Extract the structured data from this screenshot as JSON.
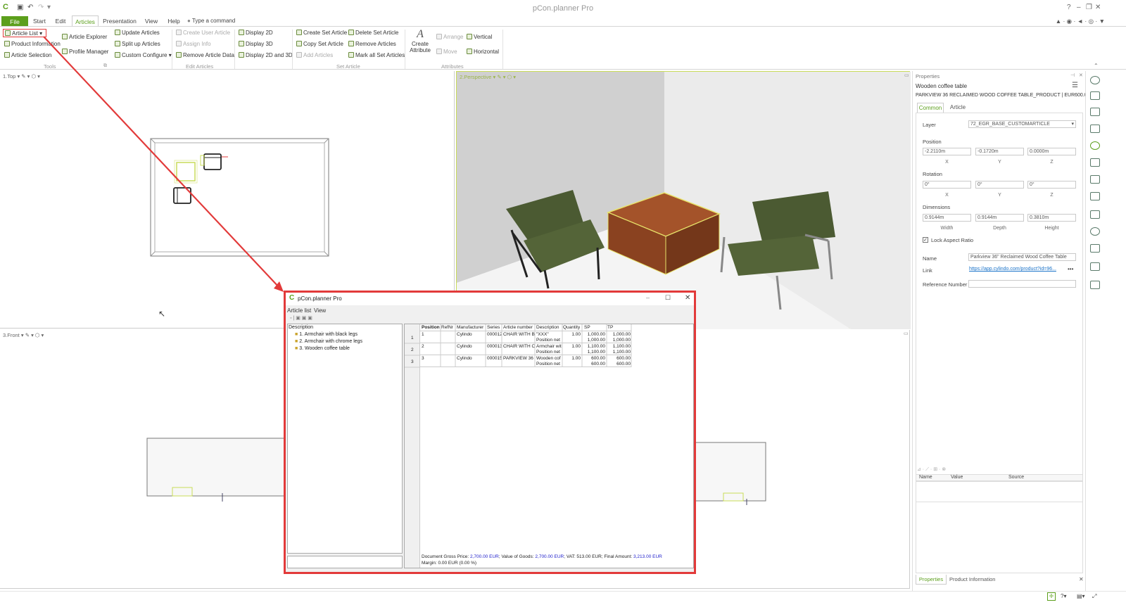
{
  "app": {
    "title": "pCon.planner Pro"
  },
  "menu": {
    "tabs": [
      "File",
      "Start",
      "Edit",
      "Articles",
      "Presentation",
      "View",
      "Help"
    ],
    "command_label": "Type a command"
  },
  "ribbon": {
    "tools": {
      "article_list": "Article List",
      "product_information": "Product Information",
      "article_selection": "Article Selection",
      "article_explorer": "Article Explorer",
      "profile_manager": "Profile Manager",
      "group": "Tools"
    },
    "articles": {
      "update": "Update Articles",
      "split": "Split up Articles",
      "custom": "Custom Configure"
    },
    "edit": {
      "create_user": "Create User Article",
      "assign_info": "Assign Info",
      "remove_data": "Remove Article Data",
      "group": "Edit Articles"
    },
    "display": {
      "d2": "Display 2D",
      "d3": "Display 3D",
      "d23": "Display 2D and 3D"
    },
    "set": {
      "create": "Create Set Article",
      "copy": "Copy Set Article",
      "add": "Add Articles",
      "delete": "Delete Set Article",
      "remove": "Remove Articles",
      "mark": "Mark all Set Articles",
      "group": "Set Article"
    },
    "attributes": {
      "create_line1": "Create",
      "create_line2": "Attribute",
      "arrange": "Arrange",
      "move": "Move",
      "vertical": "Vertical",
      "horizontal": "Horizontal",
      "group": "Attributes"
    }
  },
  "viewports": {
    "top": "1.Top",
    "perspective": "2.Perspective",
    "front": "3.Front"
  },
  "properties": {
    "header": "Properties",
    "object_name": "Wooden coffee table",
    "object_desc": "PARKVIEW 36 RECLAIMED WOOD COFFEE TABLE_PRODUCT | EUR600.00",
    "tabs": [
      "Common",
      "Article"
    ],
    "layer_label": "Layer",
    "layer_value": "72_EGR_BASE_CUSTOMARTICLE",
    "position_label": "Position",
    "position": [
      "-2.2110m",
      "-0.1720m",
      "0.0000m"
    ],
    "rotation_label": "Rotation",
    "rotation": [
      "0°",
      "0°",
      "0°"
    ],
    "axes": [
      "X",
      "Y",
      "Z"
    ],
    "dimensions_label": "Dimensions",
    "dimensions": [
      "0.9144m",
      "0.9144m",
      "0.3810m"
    ],
    "dim_labels": [
      "Width",
      "Depth",
      "Height"
    ],
    "lock_label": "Lock Aspect Ratio",
    "name_label": "Name",
    "name_value": "Parkview 36\" Reclaimed Wood Coffee Table",
    "link_label": "Link",
    "link_value": "https://app.cylindo.com/product?id=96...",
    "refnum_label": "Reference Number",
    "table_cols": [
      "Name",
      "Value",
      "Source"
    ],
    "bottom_tabs": [
      "Properties",
      "Product Information"
    ]
  },
  "dialog": {
    "title": "pCon.planner Pro",
    "menu": [
      "Article list",
      "View"
    ],
    "tree_header": "Description",
    "tree_items": [
      "1. Armchair with black legs",
      "2. Armchair with chrome legs",
      "3. Wooden coffee table"
    ],
    "columns": [
      "Position",
      "RefNr",
      "Manufacturer",
      "Series",
      "Article number",
      "Description",
      "Quantity",
      "SP",
      "TP"
    ],
    "rows": [
      {
        "rownum": "1",
        "pos": "1",
        "mfr": "Cylindo",
        "series": "000012",
        "art": "CHAIR WITH B",
        "desc": "\"XXX\"",
        "desc2": "Position net",
        "qty": "1.00",
        "sp": "1,000.00",
        "sp2": "1,000.00",
        "tp": "1,000.00",
        "tp2": "1,000.00"
      },
      {
        "rownum": "2",
        "pos": "2",
        "mfr": "Cylindo",
        "series": "000013",
        "art": "CHAIR WITH C",
        "desc": "Armchair wit",
        "desc2": "Position net",
        "qty": "1.00",
        "sp": "1,100.00",
        "sp2": "1,100.00",
        "tp": "1,100.00",
        "tp2": "1,100.00"
      },
      {
        "rownum": "3",
        "pos": "3",
        "mfr": "Cylindo",
        "series": "000015",
        "art": "PARKVIEW 36",
        "desc": "Wooden cof",
        "desc2": "Position net",
        "qty": "1.00",
        "sp": "600.00",
        "sp2": "600.00",
        "tp": "600.00",
        "tp2": "600.00"
      }
    ],
    "footer1_a": "Document Gross Price:",
    "footer1_b": "2,700.00 EUR",
    "footer1_c": "; Value of Goods:",
    "footer1_d": "2,700.00 EUR",
    "footer1_e": "; VAT: 513.00 EUR; Final Amount:",
    "footer1_f": "3,213.00 EUR",
    "footer2": "Margin: 0.00 EUR (0.00 %)"
  },
  "colors": {
    "accent": "#5c9f1c",
    "highlight": "#e23a3a",
    "link": "#1a73c9",
    "price_blue": "#2222cc"
  }
}
